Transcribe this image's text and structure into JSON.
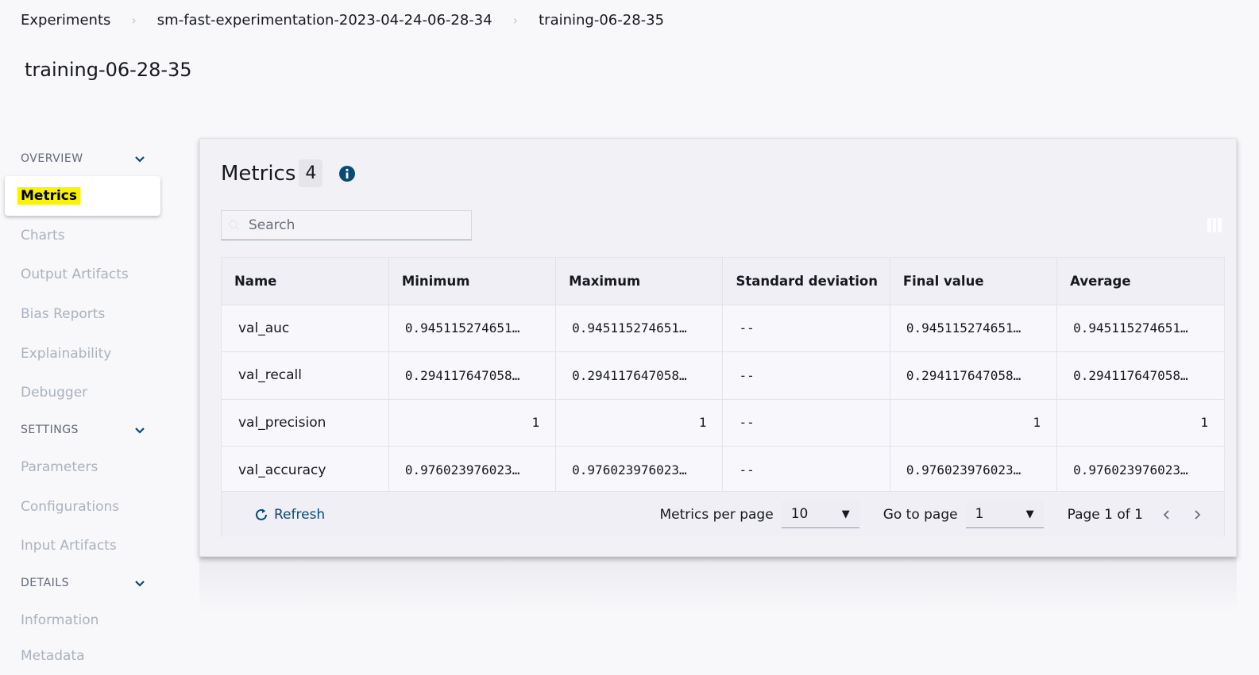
{
  "breadcrumb": [
    "Experiments",
    "sm-fast-experimentation-2023-04-24-06-28-34",
    "training-06-28-35"
  ],
  "page_title": "training-06-28-35",
  "sidebar": {
    "sections": [
      {
        "label": "OVERVIEW",
        "items": [
          "Metrics",
          "Charts",
          "Output Artifacts",
          "Bias Reports",
          "Explainability",
          "Debugger"
        ]
      },
      {
        "label": "SETTINGS",
        "items": [
          "Parameters",
          "Configurations",
          "Input Artifacts"
        ]
      },
      {
        "label": "DETAILS",
        "items": [
          "Information",
          "Metadata"
        ]
      }
    ],
    "active_item": "Metrics"
  },
  "metrics": {
    "title": "Metrics",
    "count": "4",
    "search_placeholder": "Search",
    "columns": [
      "Name",
      "Minimum",
      "Maximum",
      "Standard deviation",
      "Final value",
      "Average"
    ],
    "rows": [
      [
        "val_auc",
        "0.945115274651…",
        "0.945115274651…",
        "--",
        "0.945115274651…",
        "0.945115274651…"
      ],
      [
        "val_recall",
        "0.294117647058…",
        "0.294117647058…",
        "--",
        "0.294117647058…",
        "0.294117647058…"
      ],
      [
        "val_precision",
        "1",
        "1",
        "--",
        "1",
        "1"
      ],
      [
        "val_accuracy",
        "0.976023976023…",
        "0.976023976023…",
        "--",
        "0.976023976023…",
        "0.976023976023…"
      ]
    ],
    "footer": {
      "refresh_label": "Refresh",
      "per_page_label": "Metrics per page",
      "per_page_value": "10",
      "go_to_label": "Go to page",
      "go_to_value": "1",
      "page_info": "Page 1 of 1"
    }
  },
  "colors": {
    "accent": "#0a4a74",
    "highlight": "#f9f200"
  },
  "icons": [
    "chevron-down-icon",
    "info-icon",
    "search-icon",
    "column-preferences-icon",
    "refresh-icon",
    "chevron-left-icon",
    "chevron-right-icon"
  ]
}
